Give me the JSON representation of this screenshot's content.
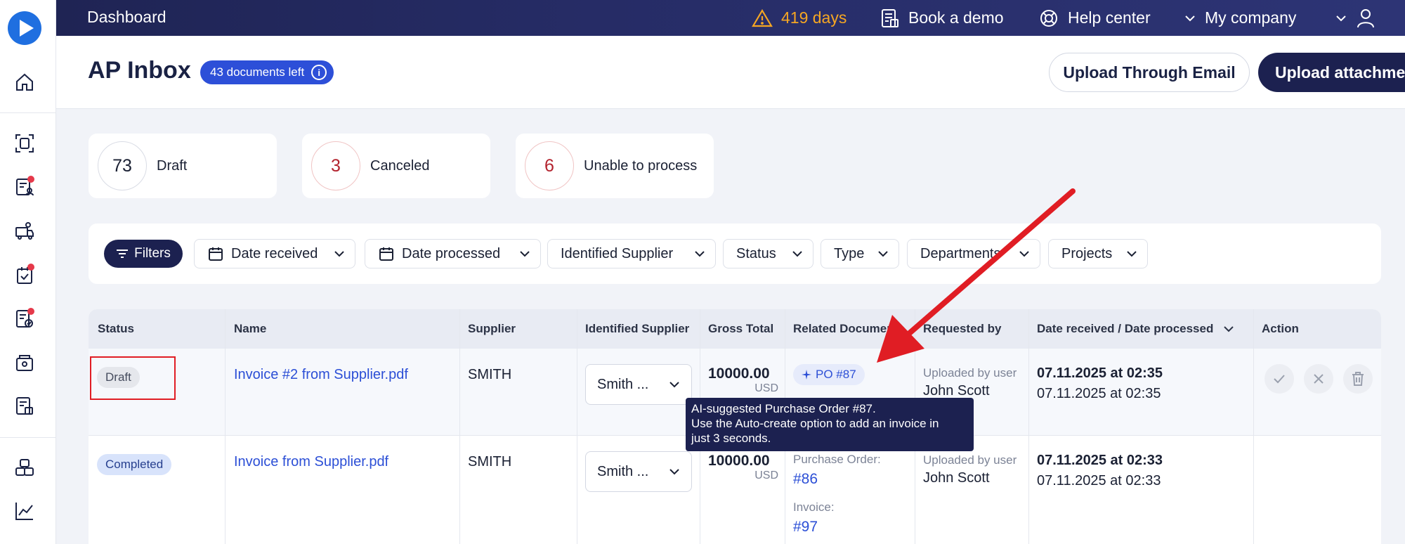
{
  "topbar": {
    "title": "Dashboard",
    "trial_days": "419 days",
    "book_demo": "Book a demo",
    "help_center": "Help center",
    "company": "My company"
  },
  "header": {
    "title": "AP Inbox",
    "docs_left": "43 documents left",
    "info_glyph": "i",
    "upload_email": "Upload Through Email",
    "upload_attachment": "Upload attachment"
  },
  "stats": [
    {
      "count": "73",
      "label": "Draft"
    },
    {
      "count": "3",
      "label": "Canceled"
    },
    {
      "count": "6",
      "label": "Unable to process"
    }
  ],
  "filters": {
    "button": "Filters",
    "dropdowns": [
      "Date received",
      "Date processed",
      "Identified Supplier",
      "Status",
      "Type",
      "Departments",
      "Projects"
    ]
  },
  "table": {
    "columns": [
      "Status",
      "Name",
      "Supplier",
      "Identified Supplier",
      "Gross Total",
      "Related Documents",
      "Requested by",
      "Date received / Date processed",
      "Action"
    ],
    "rows": [
      {
        "status": "Draft",
        "name": "Invoice #2 from Supplier.pdf",
        "supplier": "SMITH",
        "identified_supplier": "Smith ...",
        "gross": "10000.00",
        "currency": "USD",
        "related_chip": "PO #87",
        "requested_label": "Uploaded by user",
        "requested_name": "John Scott",
        "date_received": "07.11.2025 at 02:35",
        "date_processed": "07.11.2025 at 02:35"
      },
      {
        "status": "Completed",
        "name": "Invoice from Supplier.pdf",
        "supplier": "SMITH",
        "identified_supplier": "Smith ...",
        "gross": "10000.00",
        "currency": "USD",
        "po_label": "Purchase Order:",
        "po_link": "#86",
        "invoice_label": "Invoice:",
        "invoice_link": "#97",
        "requested_label": "Uploaded by user",
        "requested_name": "John Scott",
        "date_received": "07.11.2025 at 02:33",
        "date_processed": "07.11.2025 at 02:33"
      }
    ]
  },
  "tooltip": {
    "line1": "AI-suggested Purchase Order #87.",
    "line2": "Use the Auto-create option to add an invoice in",
    "line3": "just 3 seconds."
  },
  "colors": {
    "accent": "#2d4fd8",
    "dark": "#1c2150",
    "warning": "#f5a623",
    "annotation": "#e01d24"
  }
}
